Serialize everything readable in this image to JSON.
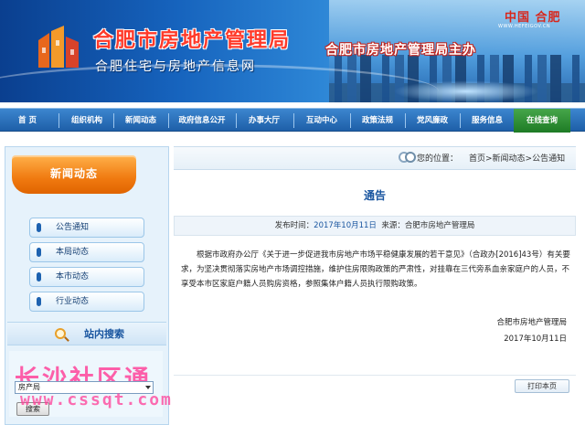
{
  "header": {
    "site_title": "合肥市房地产管理局",
    "site_subtitle": "合肥住宅与房地产信息网",
    "city_tag": "中国 合肥",
    "city_url": "WWW.HEFEIGOV.CN",
    "sponsor": "合肥市房地产管理局主办"
  },
  "nav": {
    "items": [
      {
        "label": "首 页"
      },
      {
        "label": "组织机构"
      },
      {
        "label": "新闻动态"
      },
      {
        "label": "政府信息公开"
      },
      {
        "label": "办事大厅"
      },
      {
        "label": "互动中心"
      },
      {
        "label": "政策法规"
      },
      {
        "label": "党风廉政"
      },
      {
        "label": "服务信息"
      },
      {
        "label": "在线查询"
      }
    ],
    "active_color": "#1e7b25",
    "bar_color": "#1e5fa8"
  },
  "sidebar": {
    "heading": "新闻动态",
    "items": [
      {
        "label": "公告通知"
      },
      {
        "label": "本局动态"
      },
      {
        "label": "本市动态"
      },
      {
        "label": "行业动态"
      }
    ],
    "search_heading": "站内搜索",
    "search_select_value": "房产局",
    "search_button": "搜索"
  },
  "breadcrumb": {
    "label": "您的位置：",
    "path": "首页>新闻动态>公告通知"
  },
  "article": {
    "title": "通告",
    "meta_prefix": "发布时间：",
    "date": "2017年10月11日",
    "source": "来源：合肥市房地产管理局",
    "body": "根据市政府办公厅《关于进一步促进我市房地产市场平稳健康发展的若干意见》（合政办[2016]43号）有关要求，为坚决贯彻落实房地产市场调控措施，维护住房限购政策的严肃性，对挂靠在三代旁系血亲家庭户的人员，不享受本市区家庭户籍人员购房资格，参照集体户籍人员执行限购政策。",
    "signature": "合肥市房地产管理局",
    "sign_date": "2017年10月11日",
    "print_button": "打印本页"
  },
  "watermark": {
    "name": "长沙社区通",
    "url": "www.cssqt.com"
  }
}
